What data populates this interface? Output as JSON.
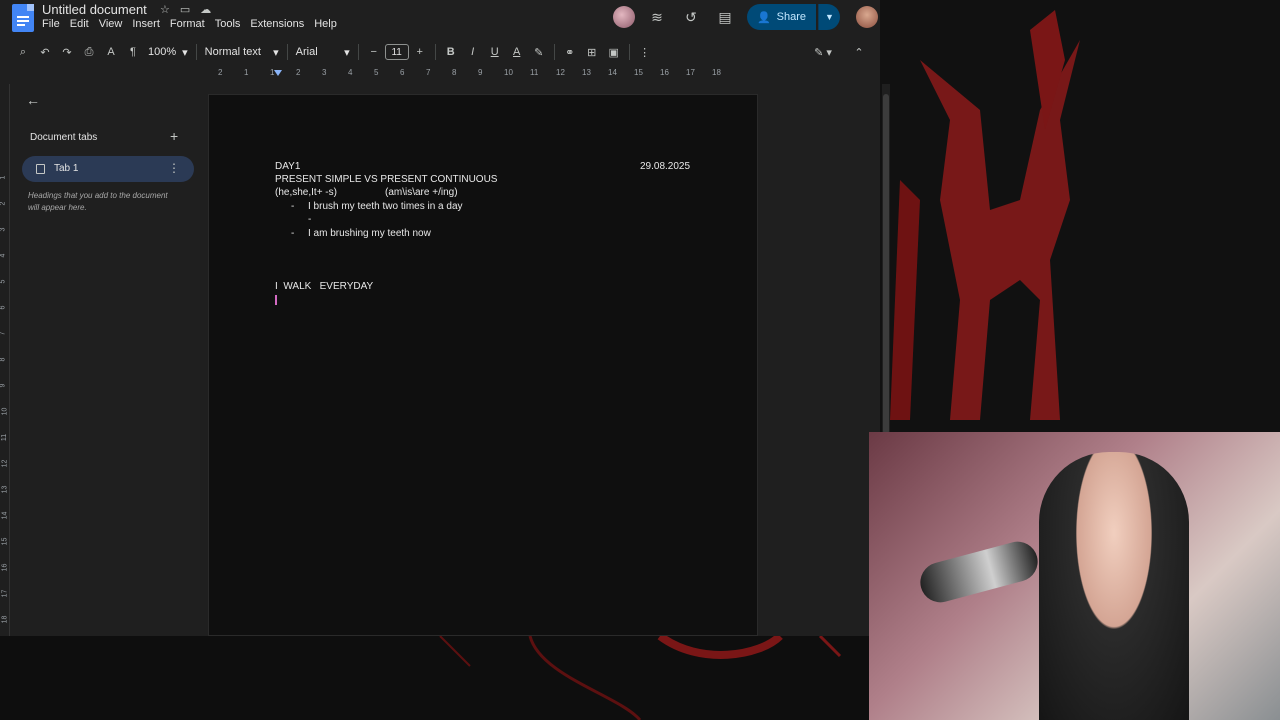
{
  "window": {
    "doc_title": "Untitled document",
    "menu": [
      "File",
      "Edit",
      "View",
      "Insert",
      "Format",
      "Tools",
      "Extensions",
      "Help"
    ],
    "share_label": "Share"
  },
  "toolbar": {
    "zoom": "100%",
    "style": "Normal text",
    "font": "Arial",
    "font_size": "11"
  },
  "ruler": {
    "ticks": [
      "2",
      "1",
      "1",
      "2",
      "3",
      "4",
      "5",
      "6",
      "7",
      "8",
      "9",
      "10",
      "11",
      "12",
      "13",
      "14",
      "15",
      "16",
      "17",
      "18"
    ]
  },
  "vruler": {
    "ticks": [
      "1",
      "2",
      "3",
      "4",
      "5",
      "6",
      "7",
      "8",
      "9",
      "10",
      "11",
      "12",
      "13",
      "14",
      "15",
      "16",
      "17",
      "18"
    ]
  },
  "sidebar": {
    "title": "Document tabs",
    "tab_label": "Tab 1",
    "hint": "Headings that you add to the document will appear here."
  },
  "document": {
    "line1_left": "DAY1",
    "line1_right": "29.08.2025",
    "line2": "PRESENT SIMPLE VS PRESENT CONTINUOUS",
    "line3_left": "(he,she,It+ -s)",
    "line3_right": "(am\\is\\are +/ing)",
    "bullet1": "I brush my teeth two times in a day",
    "bullet2": "I am brushing my teeth now",
    "line_walk": "I  WALK   EVERYDAY",
    "dash": "-"
  },
  "colors": {
    "accent": "#004a77",
    "cursor": "#d36ac2",
    "page_bg": "#0f0f0f"
  }
}
